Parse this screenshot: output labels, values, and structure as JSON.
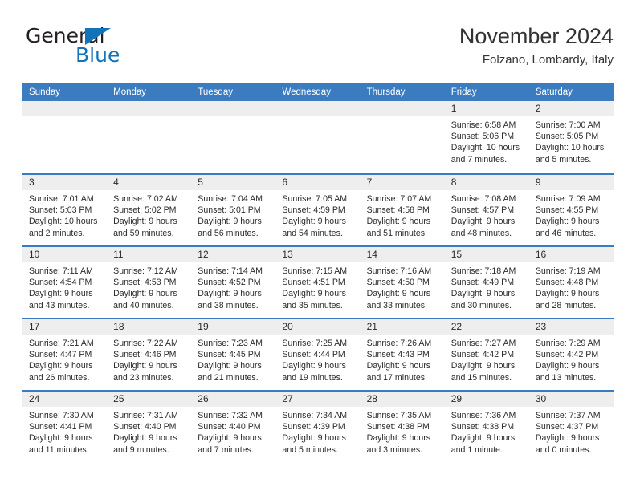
{
  "brand": {
    "name_part1": "General",
    "name_part2": "Blue",
    "color_dark": "#231f20",
    "color_blue": "#1273ba"
  },
  "header": {
    "title": "November 2024",
    "subtitle": "Folzano, Lombardy, Italy"
  },
  "theme": {
    "header_row_bg": "#3b7cc0",
    "day_strip_bg": "#eeeeee",
    "text_color": "#2b2b2b"
  },
  "weekdays": [
    "Sunday",
    "Monday",
    "Tuesday",
    "Wednesday",
    "Thursday",
    "Friday",
    "Saturday"
  ],
  "weeks": [
    [
      {
        "day": "",
        "empty": true
      },
      {
        "day": "",
        "empty": true
      },
      {
        "day": "",
        "empty": true
      },
      {
        "day": "",
        "empty": true
      },
      {
        "day": "",
        "empty": true
      },
      {
        "day": "1",
        "sunrise": "Sunrise: 6:58 AM",
        "sunset": "Sunset: 5:06 PM",
        "daylight1": "Daylight: 10 hours",
        "daylight2": "and 7 minutes."
      },
      {
        "day": "2",
        "sunrise": "Sunrise: 7:00 AM",
        "sunset": "Sunset: 5:05 PM",
        "daylight1": "Daylight: 10 hours",
        "daylight2": "and 5 minutes."
      }
    ],
    [
      {
        "day": "3",
        "sunrise": "Sunrise: 7:01 AM",
        "sunset": "Sunset: 5:03 PM",
        "daylight1": "Daylight: 10 hours",
        "daylight2": "and 2 minutes."
      },
      {
        "day": "4",
        "sunrise": "Sunrise: 7:02 AM",
        "sunset": "Sunset: 5:02 PM",
        "daylight1": "Daylight: 9 hours",
        "daylight2": "and 59 minutes."
      },
      {
        "day": "5",
        "sunrise": "Sunrise: 7:04 AM",
        "sunset": "Sunset: 5:01 PM",
        "daylight1": "Daylight: 9 hours",
        "daylight2": "and 56 minutes."
      },
      {
        "day": "6",
        "sunrise": "Sunrise: 7:05 AM",
        "sunset": "Sunset: 4:59 PM",
        "daylight1": "Daylight: 9 hours",
        "daylight2": "and 54 minutes."
      },
      {
        "day": "7",
        "sunrise": "Sunrise: 7:07 AM",
        "sunset": "Sunset: 4:58 PM",
        "daylight1": "Daylight: 9 hours",
        "daylight2": "and 51 minutes."
      },
      {
        "day": "8",
        "sunrise": "Sunrise: 7:08 AM",
        "sunset": "Sunset: 4:57 PM",
        "daylight1": "Daylight: 9 hours",
        "daylight2": "and 48 minutes."
      },
      {
        "day": "9",
        "sunrise": "Sunrise: 7:09 AM",
        "sunset": "Sunset: 4:55 PM",
        "daylight1": "Daylight: 9 hours",
        "daylight2": "and 46 minutes."
      }
    ],
    [
      {
        "day": "10",
        "sunrise": "Sunrise: 7:11 AM",
        "sunset": "Sunset: 4:54 PM",
        "daylight1": "Daylight: 9 hours",
        "daylight2": "and 43 minutes."
      },
      {
        "day": "11",
        "sunrise": "Sunrise: 7:12 AM",
        "sunset": "Sunset: 4:53 PM",
        "daylight1": "Daylight: 9 hours",
        "daylight2": "and 40 minutes."
      },
      {
        "day": "12",
        "sunrise": "Sunrise: 7:14 AM",
        "sunset": "Sunset: 4:52 PM",
        "daylight1": "Daylight: 9 hours",
        "daylight2": "and 38 minutes."
      },
      {
        "day": "13",
        "sunrise": "Sunrise: 7:15 AM",
        "sunset": "Sunset: 4:51 PM",
        "daylight1": "Daylight: 9 hours",
        "daylight2": "and 35 minutes."
      },
      {
        "day": "14",
        "sunrise": "Sunrise: 7:16 AM",
        "sunset": "Sunset: 4:50 PM",
        "daylight1": "Daylight: 9 hours",
        "daylight2": "and 33 minutes."
      },
      {
        "day": "15",
        "sunrise": "Sunrise: 7:18 AM",
        "sunset": "Sunset: 4:49 PM",
        "daylight1": "Daylight: 9 hours",
        "daylight2": "and 30 minutes."
      },
      {
        "day": "16",
        "sunrise": "Sunrise: 7:19 AM",
        "sunset": "Sunset: 4:48 PM",
        "daylight1": "Daylight: 9 hours",
        "daylight2": "and 28 minutes."
      }
    ],
    [
      {
        "day": "17",
        "sunrise": "Sunrise: 7:21 AM",
        "sunset": "Sunset: 4:47 PM",
        "daylight1": "Daylight: 9 hours",
        "daylight2": "and 26 minutes."
      },
      {
        "day": "18",
        "sunrise": "Sunrise: 7:22 AM",
        "sunset": "Sunset: 4:46 PM",
        "daylight1": "Daylight: 9 hours",
        "daylight2": "and 23 minutes."
      },
      {
        "day": "19",
        "sunrise": "Sunrise: 7:23 AM",
        "sunset": "Sunset: 4:45 PM",
        "daylight1": "Daylight: 9 hours",
        "daylight2": "and 21 minutes."
      },
      {
        "day": "20",
        "sunrise": "Sunrise: 7:25 AM",
        "sunset": "Sunset: 4:44 PM",
        "daylight1": "Daylight: 9 hours",
        "daylight2": "and 19 minutes."
      },
      {
        "day": "21",
        "sunrise": "Sunrise: 7:26 AM",
        "sunset": "Sunset: 4:43 PM",
        "daylight1": "Daylight: 9 hours",
        "daylight2": "and 17 minutes."
      },
      {
        "day": "22",
        "sunrise": "Sunrise: 7:27 AM",
        "sunset": "Sunset: 4:42 PM",
        "daylight1": "Daylight: 9 hours",
        "daylight2": "and 15 minutes."
      },
      {
        "day": "23",
        "sunrise": "Sunrise: 7:29 AM",
        "sunset": "Sunset: 4:42 PM",
        "daylight1": "Daylight: 9 hours",
        "daylight2": "and 13 minutes."
      }
    ],
    [
      {
        "day": "24",
        "sunrise": "Sunrise: 7:30 AM",
        "sunset": "Sunset: 4:41 PM",
        "daylight1": "Daylight: 9 hours",
        "daylight2": "and 11 minutes."
      },
      {
        "day": "25",
        "sunrise": "Sunrise: 7:31 AM",
        "sunset": "Sunset: 4:40 PM",
        "daylight1": "Daylight: 9 hours",
        "daylight2": "and 9 minutes."
      },
      {
        "day": "26",
        "sunrise": "Sunrise: 7:32 AM",
        "sunset": "Sunset: 4:40 PM",
        "daylight1": "Daylight: 9 hours",
        "daylight2": "and 7 minutes."
      },
      {
        "day": "27",
        "sunrise": "Sunrise: 7:34 AM",
        "sunset": "Sunset: 4:39 PM",
        "daylight1": "Daylight: 9 hours",
        "daylight2": "and 5 minutes."
      },
      {
        "day": "28",
        "sunrise": "Sunrise: 7:35 AM",
        "sunset": "Sunset: 4:38 PM",
        "daylight1": "Daylight: 9 hours",
        "daylight2": "and 3 minutes."
      },
      {
        "day": "29",
        "sunrise": "Sunrise: 7:36 AM",
        "sunset": "Sunset: 4:38 PM",
        "daylight1": "Daylight: 9 hours",
        "daylight2": "and 1 minute."
      },
      {
        "day": "30",
        "sunrise": "Sunrise: 7:37 AM",
        "sunset": "Sunset: 4:37 PM",
        "daylight1": "Daylight: 9 hours",
        "daylight2": "and 0 minutes."
      }
    ]
  ]
}
